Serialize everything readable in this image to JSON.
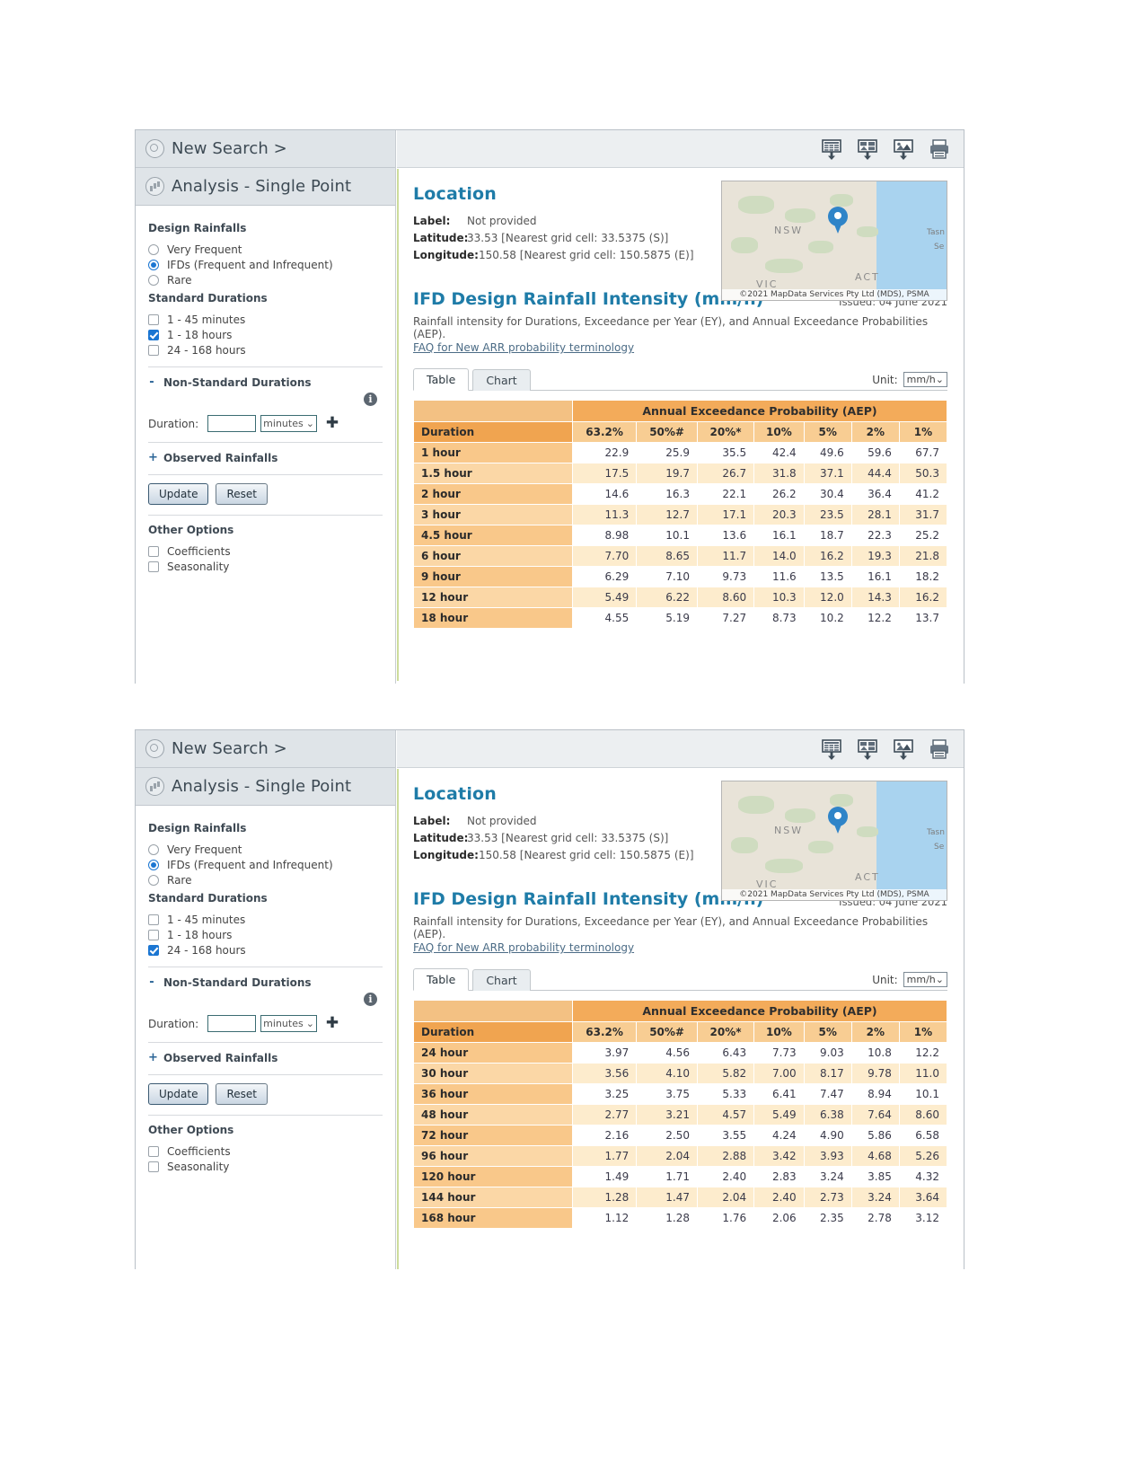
{
  "panels": [
    {
      "sidebar": {
        "new_search": "New Search >",
        "analysis_title": "Analysis - Single Point",
        "design_rainfalls_title": "Design Rainfalls",
        "design_options": [
          {
            "label": "Very Frequent",
            "checked": false
          },
          {
            "label": "IFDs (Frequent and Infrequent)",
            "checked": true
          },
          {
            "label": "Rare",
            "checked": false
          }
        ],
        "standard_durations_title": "Standard Durations",
        "duration_options": [
          {
            "label": "1 - 45 minutes",
            "checked": false
          },
          {
            "label": "1 - 18 hours",
            "checked": true
          },
          {
            "label": "24 - 168 hours",
            "checked": false
          }
        ],
        "non_standard_title": "Non-Standard Durations",
        "non_standard_toggle": "-",
        "duration_label": "Duration:",
        "duration_value": "",
        "duration_placeholder": "",
        "duration_unit": "minutes",
        "observed_title": "Observed Rainfalls",
        "observed_toggle": "+",
        "update_label": "Update",
        "reset_label": "Reset",
        "other_options_title": "Other Options",
        "other_options": [
          {
            "label": "Coefficients",
            "checked": false
          },
          {
            "label": "Seasonality",
            "checked": false
          }
        ]
      },
      "toolbar_icons": [
        "table-download-icon",
        "chart-download-icon",
        "image-download-icon",
        "print-icon"
      ],
      "location": {
        "title": "Location",
        "label_key": "Label:",
        "label_value": "Not provided",
        "latitude_key": "Latitude:",
        "latitude_value": "33.53 [Nearest grid cell: 33.5375 (S)]",
        "longitude_key": "Longitude:",
        "longitude_value": "150.58 [Nearest grid cell: 150.5875 (E)]",
        "map_labels": [
          "NSW",
          "ACT",
          "VIC",
          "Tasn",
          "Se"
        ],
        "map_credit": "©2021 MapData Services Pty Ltd (MDS), PSMA"
      },
      "ifd": {
        "title": "IFD Design Rainfall Intensity (mm/h)",
        "issued": "Issued: 04 June 2021",
        "description": "Rainfall intensity for Durations, Exceedance per Year (EY), and Annual Exceedance Probabilities (AEP).",
        "faq_link": "FAQ for New ARR probability terminology",
        "tabs": [
          {
            "label": "Table",
            "active": true
          },
          {
            "label": "Chart",
            "active": false
          }
        ],
        "unit_label": "Unit:",
        "unit_value": "mm/h"
      },
      "chart_data": {
        "type": "table",
        "title": "IFD Design Rainfall Intensity (mm/h)",
        "group_header": "Annual Exceedance Probability (AEP)",
        "row_header": "Duration",
        "categories": [
          "63.2%",
          "50%#",
          "20%*",
          "10%",
          "5%",
          "2%",
          "1%"
        ],
        "rows": [
          {
            "duration": "1 hour",
            "values": [
              "22.9",
              "25.9",
              "35.5",
              "42.4",
              "49.6",
              "59.6",
              "67.7"
            ]
          },
          {
            "duration": "1.5 hour",
            "values": [
              "17.5",
              "19.7",
              "26.7",
              "31.8",
              "37.1",
              "44.4",
              "50.3"
            ]
          },
          {
            "duration": "2 hour",
            "values": [
              "14.6",
              "16.3",
              "22.1",
              "26.2",
              "30.4",
              "36.4",
              "41.2"
            ]
          },
          {
            "duration": "3 hour",
            "values": [
              "11.3",
              "12.7",
              "17.1",
              "20.3",
              "23.5",
              "28.1",
              "31.7"
            ]
          },
          {
            "duration": "4.5 hour",
            "values": [
              "8.98",
              "10.1",
              "13.6",
              "16.1",
              "18.7",
              "22.3",
              "25.2"
            ]
          },
          {
            "duration": "6 hour",
            "values": [
              "7.70",
              "8.65",
              "11.7",
              "14.0",
              "16.2",
              "19.3",
              "21.8"
            ]
          },
          {
            "duration": "9 hour",
            "values": [
              "6.29",
              "7.10",
              "9.73",
              "11.6",
              "13.5",
              "16.1",
              "18.2"
            ]
          },
          {
            "duration": "12 hour",
            "values": [
              "5.49",
              "6.22",
              "8.60",
              "10.3",
              "12.0",
              "14.3",
              "16.2"
            ]
          },
          {
            "duration": "18 hour",
            "values": [
              "4.55",
              "5.19",
              "7.27",
              "8.73",
              "10.2",
              "12.2",
              "13.7"
            ]
          }
        ]
      }
    },
    {
      "sidebar": {
        "new_search": "New Search >",
        "analysis_title": "Analysis - Single Point",
        "design_rainfalls_title": "Design Rainfalls",
        "design_options": [
          {
            "label": "Very Frequent",
            "checked": false
          },
          {
            "label": "IFDs (Frequent and Infrequent)",
            "checked": true
          },
          {
            "label": "Rare",
            "checked": false
          }
        ],
        "standard_durations_title": "Standard Durations",
        "duration_options": [
          {
            "label": "1 - 45 minutes",
            "checked": false
          },
          {
            "label": "1 - 18 hours",
            "checked": false
          },
          {
            "label": "24 - 168 hours",
            "checked": true
          }
        ],
        "non_standard_title": "Non-Standard Durations",
        "non_standard_toggle": "-",
        "duration_label": "Duration:",
        "duration_value": "",
        "duration_placeholder": "",
        "duration_unit": "minutes",
        "observed_title": "Observed Rainfalls",
        "observed_toggle": "+",
        "update_label": "Update",
        "reset_label": "Reset",
        "other_options_title": "Other Options",
        "other_options": [
          {
            "label": "Coefficients",
            "checked": false
          },
          {
            "label": "Seasonality",
            "checked": false
          }
        ]
      },
      "toolbar_icons": [
        "table-download-icon",
        "chart-download-icon",
        "image-download-icon",
        "print-icon"
      ],
      "location": {
        "title": "Location",
        "label_key": "Label:",
        "label_value": "Not provided",
        "latitude_key": "Latitude:",
        "latitude_value": "33.53 [Nearest grid cell: 33.5375 (S)]",
        "longitude_key": "Longitude:",
        "longitude_value": "150.58 [Nearest grid cell: 150.5875 (E)]",
        "map_labels": [
          "NSW",
          "ACT",
          "VIC",
          "Tasn",
          "Se"
        ],
        "map_credit": "©2021 MapData Services Pty Ltd (MDS), PSMA"
      },
      "ifd": {
        "title": "IFD Design Rainfall Intensity (mm/h)",
        "issued": "Issued: 04 June 2021",
        "description": "Rainfall intensity for Durations, Exceedance per Year (EY), and Annual Exceedance Probabilities (AEP).",
        "faq_link": "FAQ for New ARR probability terminology",
        "tabs": [
          {
            "label": "Table",
            "active": true
          },
          {
            "label": "Chart",
            "active": false
          }
        ],
        "unit_label": "Unit:",
        "unit_value": "mm/h"
      },
      "chart_data": {
        "type": "table",
        "title": "IFD Design Rainfall Intensity (mm/h)",
        "group_header": "Annual Exceedance Probability (AEP)",
        "row_header": "Duration",
        "categories": [
          "63.2%",
          "50%#",
          "20%*",
          "10%",
          "5%",
          "2%",
          "1%"
        ],
        "rows": [
          {
            "duration": "24 hour",
            "values": [
              "3.97",
              "4.56",
              "6.43",
              "7.73",
              "9.03",
              "10.8",
              "12.2"
            ]
          },
          {
            "duration": "30 hour",
            "values": [
              "3.56",
              "4.10",
              "5.82",
              "7.00",
              "8.17",
              "9.78",
              "11.0"
            ]
          },
          {
            "duration": "36 hour",
            "values": [
              "3.25",
              "3.75",
              "5.33",
              "6.41",
              "7.47",
              "8.94",
              "10.1"
            ]
          },
          {
            "duration": "48 hour",
            "values": [
              "2.77",
              "3.21",
              "4.57",
              "5.49",
              "6.38",
              "7.64",
              "8.60"
            ]
          },
          {
            "duration": "72 hour",
            "values": [
              "2.16",
              "2.50",
              "3.55",
              "4.24",
              "4.90",
              "5.86",
              "6.58"
            ]
          },
          {
            "duration": "96 hour",
            "values": [
              "1.77",
              "2.04",
              "2.88",
              "3.42",
              "3.93",
              "4.68",
              "5.26"
            ]
          },
          {
            "duration": "120 hour",
            "values": [
              "1.49",
              "1.71",
              "2.40",
              "2.83",
              "3.24",
              "3.85",
              "4.32"
            ]
          },
          {
            "duration": "144 hour",
            "values": [
              "1.28",
              "1.47",
              "2.04",
              "2.40",
              "2.73",
              "3.24",
              "3.64"
            ]
          },
          {
            "duration": "168 hour",
            "values": [
              "1.12",
              "1.28",
              "1.76",
              "2.06",
              "2.35",
              "2.78",
              "3.12"
            ]
          }
        ]
      }
    }
  ]
}
